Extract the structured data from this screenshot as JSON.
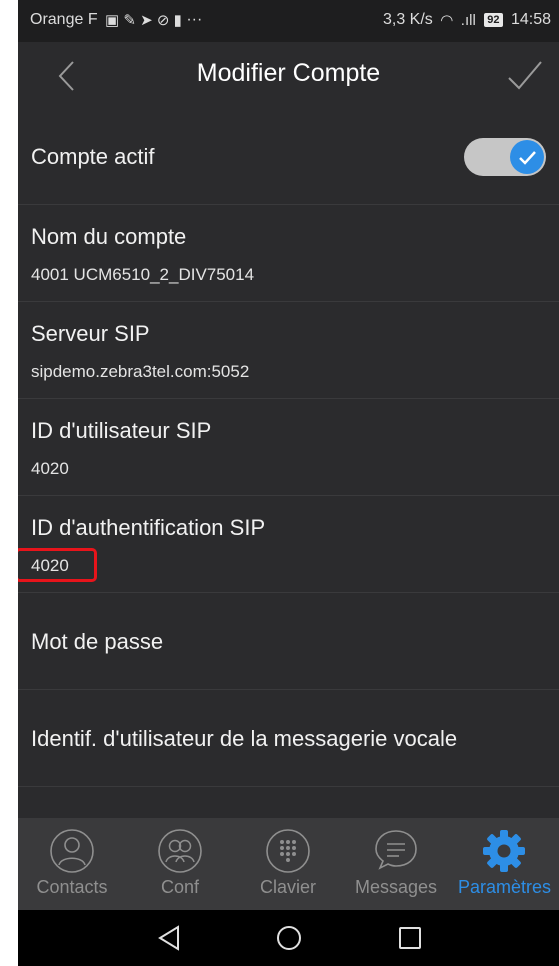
{
  "status_bar": {
    "carrier": "Orange F",
    "overflow": "···",
    "speed": "3,3 K/s",
    "battery": "92",
    "time": "14:58"
  },
  "header": {
    "title": "Modifier Compte",
    "back_icon": "chevron-left-icon",
    "confirm_icon": "checkmark-icon"
  },
  "settings": {
    "account_active": {
      "label": "Compte actif",
      "enabled": true
    },
    "account_name": {
      "label": "Nom du compte",
      "value": "4001 UCM6510_2_DIV75014"
    },
    "sip_server": {
      "label": "Serveur SIP",
      "value": "sipdemo.zebra3tel.com:5052"
    },
    "sip_user_id": {
      "label": "ID d'utilisateur SIP",
      "value": "4020"
    },
    "sip_auth_id": {
      "label": "ID d'authentification SIP",
      "value": "4020"
    },
    "password": {
      "label": "Mot de passe"
    },
    "voicemail_user_id": {
      "label": "Identif. d'utilisateur de la messagerie vocale"
    }
  },
  "bottom_nav": {
    "items": [
      {
        "label": "Contacts",
        "icon": "person-icon"
      },
      {
        "label": "Conf",
        "icon": "group-icon"
      },
      {
        "label": "Clavier",
        "icon": "dialpad-icon"
      },
      {
        "label": "Messages",
        "icon": "chat-bubble-icon"
      },
      {
        "label": "Paramètres",
        "icon": "gear-icon",
        "active": true
      }
    ]
  },
  "colors": {
    "accent": "#2d8ee6",
    "background": "#2b2b2d",
    "highlight": "#e8141b"
  }
}
